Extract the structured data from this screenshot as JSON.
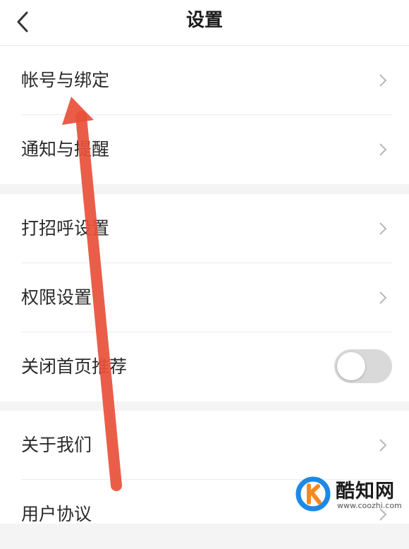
{
  "header": {
    "title": "设置"
  },
  "groups": [
    {
      "items": [
        {
          "label": "帐号与绑定",
          "control": "chevron"
        },
        {
          "label": "通知与提醒",
          "control": "chevron"
        }
      ]
    },
    {
      "items": [
        {
          "label": "打招呼设置",
          "control": "chevron"
        },
        {
          "label": "权限设置",
          "control": "chevron"
        },
        {
          "label": "关闭首页推荐",
          "control": "toggle",
          "toggle_on": false
        }
      ]
    },
    {
      "items": [
        {
          "label": "关于我们",
          "control": "chevron"
        },
        {
          "label": "用户协议",
          "control": "chevron"
        }
      ]
    }
  ],
  "annotation": {
    "type": "red-arrow",
    "color": "#e8503a",
    "points_to": "帐号与绑定"
  },
  "watermark": {
    "name": "酷知网",
    "url": "www.coozhi.com",
    "logo_colors": [
      "#1e88e5",
      "#f5891f"
    ]
  },
  "icons": [
    "back-arrow-icon",
    "chevron-right-icon",
    "toggle-switch"
  ]
}
